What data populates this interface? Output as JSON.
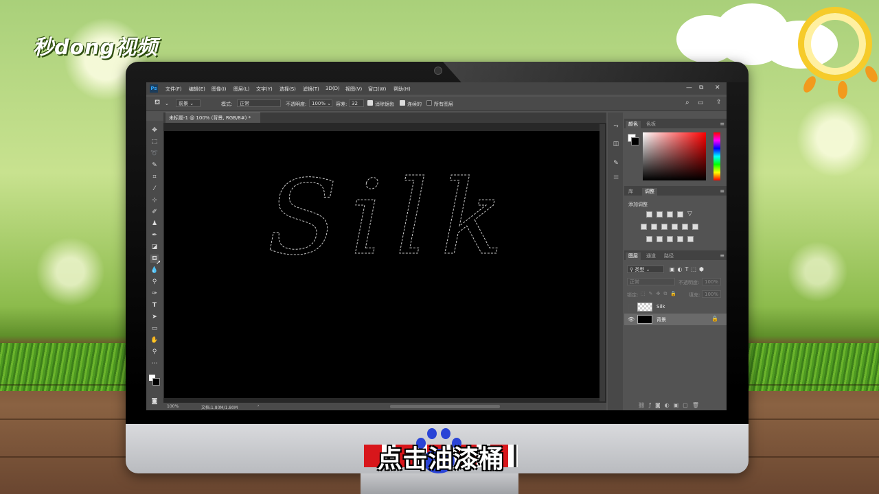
{
  "brand": {
    "logo_text": "秒dong视频"
  },
  "caption": "点击油漆桶",
  "photoshop": {
    "app_icon": "Ps",
    "menu": [
      "文件(F)",
      "编辑(E)",
      "图像(I)",
      "图层(L)",
      "文字(Y)",
      "选择(S)",
      "滤镜(T)",
      "3D(D)",
      "视图(V)",
      "窗口(W)",
      "帮助(H)"
    ],
    "window_buttons": {
      "minimize": "—",
      "restore": "⧉",
      "close": "✕"
    },
    "options": {
      "fill_source": "前景",
      "mode_label": "模式:",
      "mode_value": "正常",
      "opacity_label": "不透明度:",
      "opacity_value": "100%",
      "tolerance_label": "容差:",
      "tolerance_value": "32",
      "antialias_label": "消除锯齿",
      "contiguous_label": "连续的",
      "all_layers_label": "所有图层"
    },
    "document_tab": {
      "title": "未标题-1 @ 100% (背景, RGB/8#) *",
      "close": "×"
    },
    "status": {
      "zoom": "100%",
      "doc_size": "文档:1.80M/1.80M",
      "arrow": "›"
    },
    "canvas_text": "Silk",
    "color_panel": {
      "tabs": [
        "颜色",
        "色板"
      ]
    },
    "adjust_panel": {
      "tabs": [
        "库",
        "调整"
      ],
      "add_label": "添加调整"
    },
    "layers_panel": {
      "tabs": [
        "图层",
        "通道",
        "路径"
      ],
      "kind_filter": "类型",
      "blend_mode": "正常",
      "opacity_label": "不透明度:",
      "opacity_value": "100%",
      "lock_label": "锁定:",
      "fill_label": "填充:",
      "fill_value": "100%",
      "layers": [
        {
          "name": "Silk",
          "visible": false,
          "thumb": "transparent"
        },
        {
          "name": "背景",
          "visible": true,
          "thumb": "black",
          "locked": true,
          "selected": true
        }
      ]
    }
  }
}
